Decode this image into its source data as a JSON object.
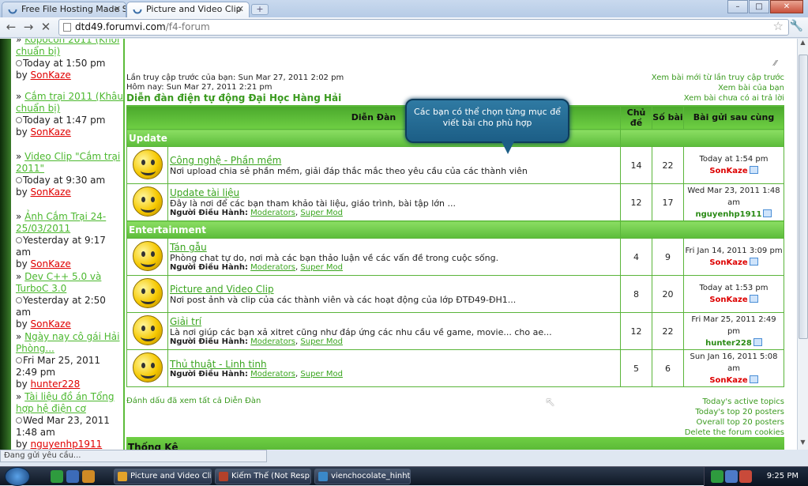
{
  "browser": {
    "tabs": [
      {
        "label": "Free File Hosting Made Si..."
      },
      {
        "label": "Picture and Video Clip"
      }
    ],
    "url": {
      "host": "dtd49.forumvi.com",
      "path": "/f4-forum"
    }
  },
  "left_posts": [
    {
      "title": "Kopocon 2011 (Khởi chuẩn bị)",
      "time": "Today at 1:50 pm",
      "by_label": "by",
      "user": "SonKaze"
    },
    {
      "title": "Cắm trại 2011 (Khâu chuẩn bị)",
      "time": "Today at 1:47 pm",
      "by_label": "by",
      "user": "SonKaze"
    },
    {
      "title": "Video Clip \"Cắm trại 2011\"",
      "time": "Today at 9:30 am",
      "by_label": "by",
      "user": "SonKaze"
    },
    {
      "title": "Ảnh Cắm Trại 24-25/03/2011",
      "time": "Yesterday at 9:17 am",
      "by_label": "by",
      "user": "SonKaze"
    },
    {
      "title": "Dev C++ 5.0 và TurboC 3.0",
      "time": "Yesterday at 2:50 am",
      "by_label": "by",
      "user": "SonKaze"
    },
    {
      "title": "Ngày nay cô gái Hải Phòng...",
      "time": "Fri Mar 25, 2011 2:49 pm",
      "by_label": "by",
      "user": "hunter228"
    },
    {
      "title": "Tài liệu đồ án Tổng hợp hệ điện cơ",
      "time": "Wed Mar 23, 2011 1:48 am",
      "by_label": "by",
      "user": "nguyenhp1911"
    }
  ],
  "visit": {
    "last": "Lần truy cập trước của bạn: Sun Mar 27, 2011 2:02 pm",
    "now": "Hôm nay: Sun Mar 27, 2011 2:21 pm"
  },
  "breadcrumb": "Diễn đàn điện tự động Đại Học Hàng Hải",
  "right_links": [
    "Xem bài mới từ lần truy cập trước",
    "Xem bài của bạn",
    "Xem bài chưa có ai trả lời"
  ],
  "table_headers": {
    "forum": "Diễn Đàn",
    "topics": "Chủ đề",
    "posts": "Số bài",
    "last": "Bài gửi sau cùng"
  },
  "mods_label": "Người Điều Hành:",
  "mod_links": [
    "Moderators",
    "Super Mod"
  ],
  "categories": [
    {
      "name": "Update",
      "forums": [
        {
          "name": "Công nghệ - Phần mềm",
          "desc": "Nơi upload chia sẻ phần mềm, giải đáp thắc mắc theo yêu cầu của các thành viên",
          "mods": false,
          "topics": "14",
          "posts": "22",
          "last_time": "Today at 1:54 pm",
          "last_user": "SonKaze"
        },
        {
          "name": "Update tài liệu",
          "desc": "Đây là nơi để các bạn tham khảo tài liệu, giáo trình, bài tập lớn ...",
          "mods": true,
          "topics": "12",
          "posts": "17",
          "last_time": "Wed Mar 23, 2011 1:48 am",
          "last_user": "nguyenhp1911"
        }
      ]
    },
    {
      "name": "Entertainment",
      "forums": [
        {
          "name": "Tán gẫu",
          "desc": "Phòng chat tự do, nơi mà các bạn thảo luận về các vấn đề trong cuộc sống.",
          "mods": true,
          "topics": "4",
          "posts": "9",
          "last_time": "Fri Jan 14, 2011 3:09 pm",
          "last_user": "SonKaze"
        },
        {
          "name": "Picture and Video Clip",
          "desc": "Nơi post ảnh và clip của các thành viên và các hoạt động của lớp ĐTĐ49-ĐH1...",
          "mods": false,
          "topics": "8",
          "posts": "20",
          "last_time": "Today at 1:53 pm",
          "last_user": "SonKaze"
        },
        {
          "name": "Giải trí",
          "desc": "Là nơi giúp các bạn xả xitret cũng như đáp ứng các nhu cầu về game, movie... cho ae...",
          "mods": true,
          "topics": "12",
          "posts": "22",
          "last_time": "Fri Mar 25, 2011 2:49 pm",
          "last_user": "hunter228"
        },
        {
          "name": "Thủ thuật - Linh tinh",
          "desc": "",
          "mods": true,
          "topics": "5",
          "posts": "6",
          "last_time": "Sun Jan 16, 2011 5:08 am",
          "last_user": "SonKaze"
        }
      ]
    }
  ],
  "tooltip": "Các bạn có thể chọn từng mục để viết bài cho phù hợp",
  "mark_read": "Đánh dấu đã xem tất cả Diễn Đàn",
  "bottom_links": [
    "Today's active topics",
    "Today's top 20 posters",
    "Overall top 20 posters",
    "Delete the forum cookies"
  ],
  "stats_title": "Thống Kê",
  "status": "Đang gửi yêu cầu...",
  "taskbar": {
    "items": [
      "Picture and Video Cli...",
      "Kiếm Thế (Not Resp...",
      "vienchocolate_hinhti..."
    ],
    "clock": "9:25 PM"
  }
}
